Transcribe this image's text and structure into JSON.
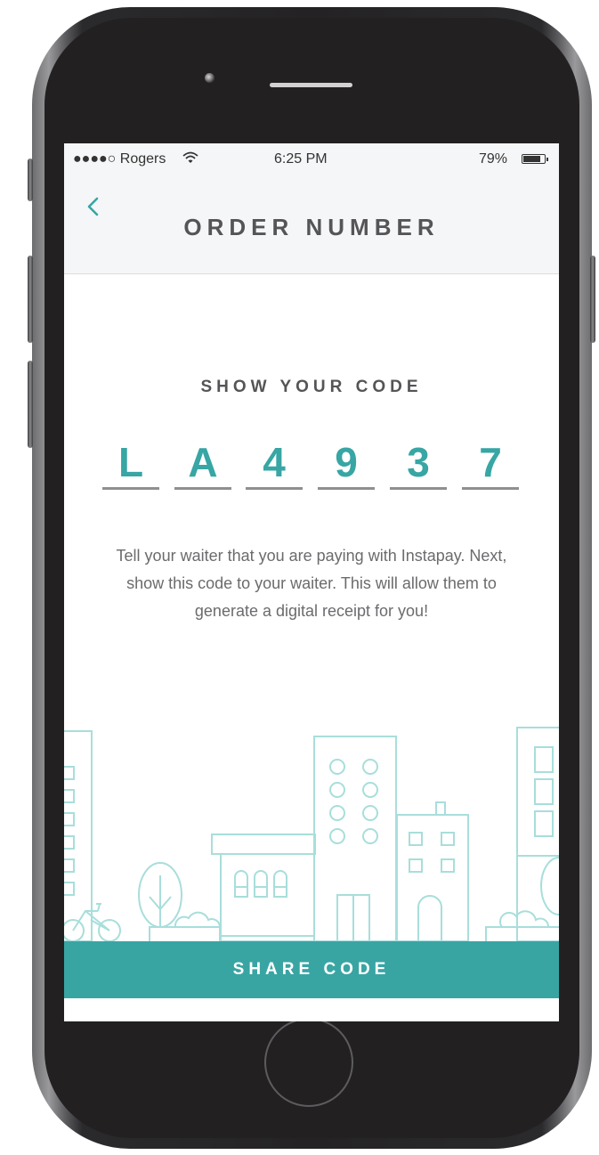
{
  "status_bar": {
    "carrier": "●●●●○ Rogers",
    "time": "6:25 PM",
    "battery": "79%"
  },
  "nav": {
    "title": "ORDER NUMBER",
    "back_icon": "chevron-left-icon"
  },
  "main": {
    "heading": "SHOW YOUR CODE",
    "code": [
      "L",
      "A",
      "4",
      "9",
      "3",
      "7"
    ],
    "instructions": "Tell your waiter that you are paying with Instapay. Next, show this code to your waiter. This will allow them to generate a digital receipt for you!"
  },
  "footer": {
    "share_label": "SHARE CODE"
  },
  "colors": {
    "accent": "#38a5a3",
    "illustration": "#a8dedb",
    "text_dark": "#555558"
  }
}
